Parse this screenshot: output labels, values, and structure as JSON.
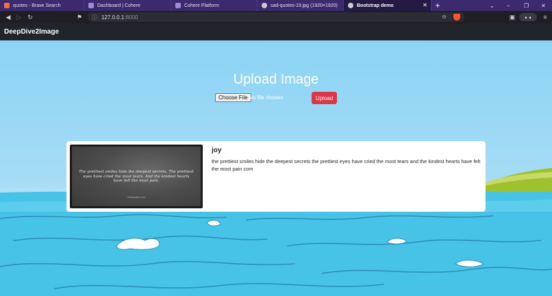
{
  "browser": {
    "tabs": [
      {
        "title": "quotes - Brave Search",
        "favicon_color": "#ff6a3d"
      },
      {
        "title": "Dashboard | Cohere",
        "favicon_color": "#9a8ad8"
      },
      {
        "title": "Cohere Platform",
        "favicon_color": "#9a8ad8"
      },
      {
        "title": "sad-quotes-19.jpg (1920×1920)",
        "favicon_color": "#cccccc"
      },
      {
        "title": "Bootstrap demo",
        "favicon_color": "#cccccc",
        "active": true
      }
    ],
    "new_tab": "+",
    "url": {
      "host": "127.0.0.1",
      "port": ":8000"
    },
    "window_controls": {
      "chevron": "⌄",
      "minimize": "–",
      "restore": "❐",
      "close": "✕"
    },
    "icons": [
      "back-icon",
      "forward-icon",
      "reload-icon",
      "bookmark-icon",
      "info-icon",
      "zoom-icon",
      "brave-shield-icon",
      "sidebar-icon",
      "wallet-icon",
      "menu-icon"
    ]
  },
  "navbar": {
    "brand": "DeepDive2Image"
  },
  "upload": {
    "title": "Upload Image",
    "choose_label": "Choose File",
    "file_status": "No file chosen",
    "upload_label": "Upload"
  },
  "result": {
    "emotion": "joy",
    "caption": "the prettiest smiles hide the deepest secrets the prettiest eyes have cried the most tears and the kindest hearts have felt the most pain com",
    "image_text": "The prettiest smiles hide the deepest secrets. The prettiest eyes have cried the most tears. And the kindest hearts have felt the most pain.",
    "watermark": "Ninequotes.com"
  },
  "colors": {
    "upload_button": "#dc3545",
    "navbar": "#212529",
    "tab_strip": "#3b2a6e"
  }
}
